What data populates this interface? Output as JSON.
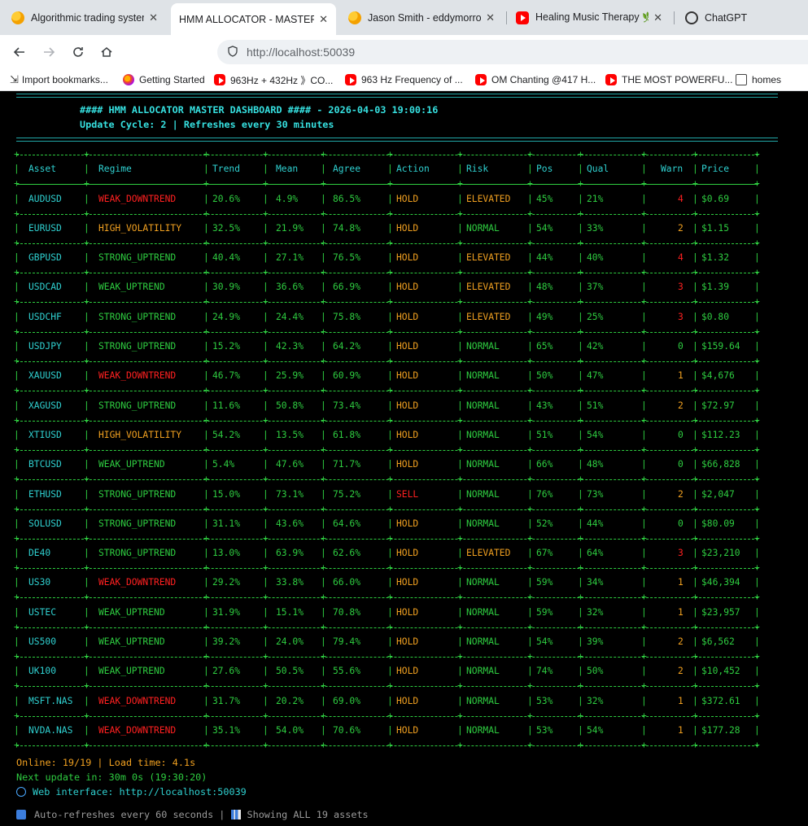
{
  "browser": {
    "tabs": [
      {
        "title": "Algorithmic trading systems",
        "icon": "huggingface-icon",
        "active": false
      },
      {
        "title": "HMM ALLOCATOR - MASTER DA",
        "icon": "blank",
        "active": true
      },
      {
        "title": "Jason Smith - eddymorrow -",
        "icon": "huggingface-icon",
        "active": false
      },
      {
        "title": "Healing Music Therapy 🌿 R",
        "icon": "youtube-icon",
        "active": false
      },
      {
        "title": "ChatGPT",
        "icon": "chatgpt-icon",
        "active": false
      }
    ],
    "close_glyph": "✕",
    "url_host": "http://localhost",
    "url_port": ":50039",
    "bookmarks": [
      {
        "label": "Import bookmarks...",
        "icon": "import-icon"
      },
      {
        "label": "Getting Started",
        "icon": "firefox-icon"
      },
      {
        "label": "963Hz + 432Hz 》CO...",
        "icon": "youtube-icon"
      },
      {
        "label": "963 Hz Frequency of ...",
        "icon": "youtube-icon"
      },
      {
        "label": "OM Chanting @417 H...",
        "icon": "youtube-icon"
      },
      {
        "label": "THE MOST POWERFU...",
        "icon": "youtube-icon"
      },
      {
        "label": "homes",
        "icon": "folder-icon"
      }
    ]
  },
  "dashboard": {
    "title_line": "#### HMM ALLOCATOR MASTER DASHBOARD #### - 2026-04-03 19:00:16",
    "update_line": "Update Cycle: 2 | Refreshes every 30 minutes",
    "columns": [
      "Asset",
      "Regime",
      "Trend",
      "Mean",
      "Agree",
      "Action",
      "Risk",
      "Pos",
      "Qual",
      "Warn",
      "Price"
    ],
    "rows": [
      {
        "asset": "AUDUSD",
        "regime": "WEAK_DOWNTREND",
        "trend": "20.6%",
        "mean": "4.9%",
        "agree": "86.5%",
        "action": "HOLD",
        "risk": "ELEVATED",
        "pos": "45%",
        "qual": "21%",
        "warn": "4",
        "price": "$0.69"
      },
      {
        "asset": "EURUSD",
        "regime": "HIGH_VOLATILITY",
        "trend": "32.5%",
        "mean": "21.9%",
        "agree": "74.8%",
        "action": "HOLD",
        "risk": "NORMAL",
        "pos": "54%",
        "qual": "33%",
        "warn": "2",
        "price": "$1.15"
      },
      {
        "asset": "GBPUSD",
        "regime": "STRONG_UPTREND",
        "trend": "40.4%",
        "mean": "27.1%",
        "agree": "76.5%",
        "action": "HOLD",
        "risk": "ELEVATED",
        "pos": "44%",
        "qual": "40%",
        "warn": "4",
        "price": "$1.32"
      },
      {
        "asset": "USDCAD",
        "regime": "WEAK_UPTREND",
        "trend": "30.9%",
        "mean": "36.6%",
        "agree": "66.9%",
        "action": "HOLD",
        "risk": "ELEVATED",
        "pos": "48%",
        "qual": "37%",
        "warn": "3",
        "price": "$1.39"
      },
      {
        "asset": "USDCHF",
        "regime": "STRONG_UPTREND",
        "trend": "24.9%",
        "mean": "24.4%",
        "agree": "75.8%",
        "action": "HOLD",
        "risk": "ELEVATED",
        "pos": "49%",
        "qual": "25%",
        "warn": "3",
        "price": "$0.80"
      },
      {
        "asset": "USDJPY",
        "regime": "STRONG_UPTREND",
        "trend": "15.2%",
        "mean": "42.3%",
        "agree": "64.2%",
        "action": "HOLD",
        "risk": "NORMAL",
        "pos": "65%",
        "qual": "42%",
        "warn": "0",
        "price": "$159.64"
      },
      {
        "asset": "XAUUSD",
        "regime": "WEAK_DOWNTREND",
        "trend": "46.7%",
        "mean": "25.9%",
        "agree": "60.9%",
        "action": "HOLD",
        "risk": "NORMAL",
        "pos": "50%",
        "qual": "47%",
        "warn": "1",
        "price": "$4,676"
      },
      {
        "asset": "XAGUSD",
        "regime": "STRONG_UPTREND",
        "trend": "11.6%",
        "mean": "50.8%",
        "agree": "73.4%",
        "action": "HOLD",
        "risk": "NORMAL",
        "pos": "43%",
        "qual": "51%",
        "warn": "2",
        "price": "$72.97"
      },
      {
        "asset": "XTIUSD",
        "regime": "HIGH_VOLATILITY",
        "trend": "54.2%",
        "mean": "13.5%",
        "agree": "61.8%",
        "action": "HOLD",
        "risk": "NORMAL",
        "pos": "51%",
        "qual": "54%",
        "warn": "0",
        "price": "$112.23"
      },
      {
        "asset": "BTCUSD",
        "regime": "WEAK_UPTREND",
        "trend": "5.4%",
        "mean": "47.6%",
        "agree": "71.7%",
        "action": "HOLD",
        "risk": "NORMAL",
        "pos": "66%",
        "qual": "48%",
        "warn": "0",
        "price": "$66,828"
      },
      {
        "asset": "ETHUSD",
        "regime": "STRONG_UPTREND",
        "trend": "15.0%",
        "mean": "73.1%",
        "agree": "75.2%",
        "action": "SELL",
        "risk": "NORMAL",
        "pos": "76%",
        "qual": "73%",
        "warn": "2",
        "price": "$2,047"
      },
      {
        "asset": "SOLUSD",
        "regime": "STRONG_UPTREND",
        "trend": "31.1%",
        "mean": "43.6%",
        "agree": "64.6%",
        "action": "HOLD",
        "risk": "NORMAL",
        "pos": "52%",
        "qual": "44%",
        "warn": "0",
        "price": "$80.09"
      },
      {
        "asset": "DE40",
        "regime": "STRONG_UPTREND",
        "trend": "13.0%",
        "mean": "63.9%",
        "agree": "62.6%",
        "action": "HOLD",
        "risk": "ELEVATED",
        "pos": "67%",
        "qual": "64%",
        "warn": "3",
        "price": "$23,210"
      },
      {
        "asset": "US30",
        "regime": "WEAK_DOWNTREND",
        "trend": "29.2%",
        "mean": "33.8%",
        "agree": "66.0%",
        "action": "HOLD",
        "risk": "NORMAL",
        "pos": "59%",
        "qual": "34%",
        "warn": "1",
        "price": "$46,394"
      },
      {
        "asset": "USTEC",
        "regime": "WEAK_UPTREND",
        "trend": "31.9%",
        "mean": "15.1%",
        "agree": "70.8%",
        "action": "HOLD",
        "risk": "NORMAL",
        "pos": "59%",
        "qual": "32%",
        "warn": "1",
        "price": "$23,957"
      },
      {
        "asset": "US500",
        "regime": "WEAK_UPTREND",
        "trend": "39.2%",
        "mean": "24.0%",
        "agree": "79.4%",
        "action": "HOLD",
        "risk": "NORMAL",
        "pos": "54%",
        "qual": "39%",
        "warn": "2",
        "price": "$6,562"
      },
      {
        "asset": "UK100",
        "regime": "WEAK_UPTREND",
        "trend": "27.6%",
        "mean": "50.5%",
        "agree": "55.6%",
        "action": "HOLD",
        "risk": "NORMAL",
        "pos": "74%",
        "qual": "50%",
        "warn": "2",
        "price": "$10,452"
      },
      {
        "asset": "MSFT.NAS",
        "regime": "WEAK_DOWNTREND",
        "trend": "31.7%",
        "mean": "20.2%",
        "agree": "69.0%",
        "action": "HOLD",
        "risk": "NORMAL",
        "pos": "53%",
        "qual": "32%",
        "warn": "1",
        "price": "$372.61"
      },
      {
        "asset": "NVDA.NAS",
        "regime": "WEAK_DOWNTREND",
        "trend": "35.1%",
        "mean": "54.0%",
        "agree": "70.6%",
        "action": "HOLD",
        "risk": "NORMAL",
        "pos": "53%",
        "qual": "54%",
        "warn": "1",
        "price": "$177.28"
      }
    ],
    "footer": {
      "online_line": "Online: 19/19 | Load time: 4.1s",
      "next_update_line": "Next update in: 30m 0s (19:30:20)",
      "web_interface_line": "Web interface: http://localhost:50039",
      "auto_refresh_text": "Auto-refreshes every 60 seconds |",
      "showing_text": "Showing ALL 19 assets"
    },
    "colors": {
      "cyan": "#2fd0d0",
      "green": "#2ecc40",
      "red": "#ff2020",
      "orange": "#f0a020"
    }
  }
}
